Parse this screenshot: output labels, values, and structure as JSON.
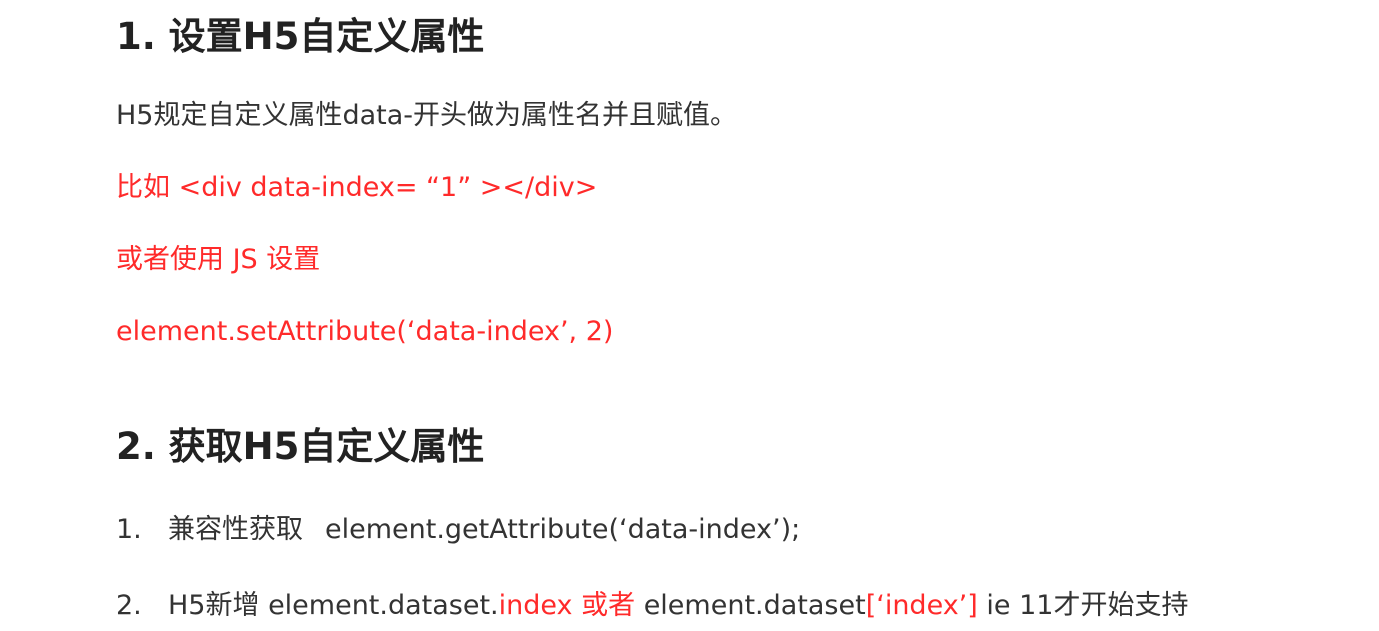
{
  "section1": {
    "heading": "1. 设置H5自定义属性",
    "desc": "H5规定自定义属性data-开头做为属性名并且赋值。",
    "example": "比如 <div data-index= “1” ></div>",
    "or_js": "或者使用 JS 设置",
    "code": "element.setAttribute(‘data-index’, 2)"
  },
  "section2": {
    "heading": "2. 获取H5自定义属性",
    "items": [
      {
        "num": "1.",
        "text": "兼容性获取",
        "code": "element.getAttribute(‘data-index’);"
      },
      {
        "num": "2.",
        "part1": "H5新增 element.dataset.",
        "part2": "index 或者",
        "part3": " element.dataset",
        "part4": "[‘index’]",
        "part5": " ie 11才开始支持"
      }
    ]
  },
  "colors": {
    "accent": "#ff2a2a",
    "text": "#333333",
    "heading": "#222222"
  }
}
